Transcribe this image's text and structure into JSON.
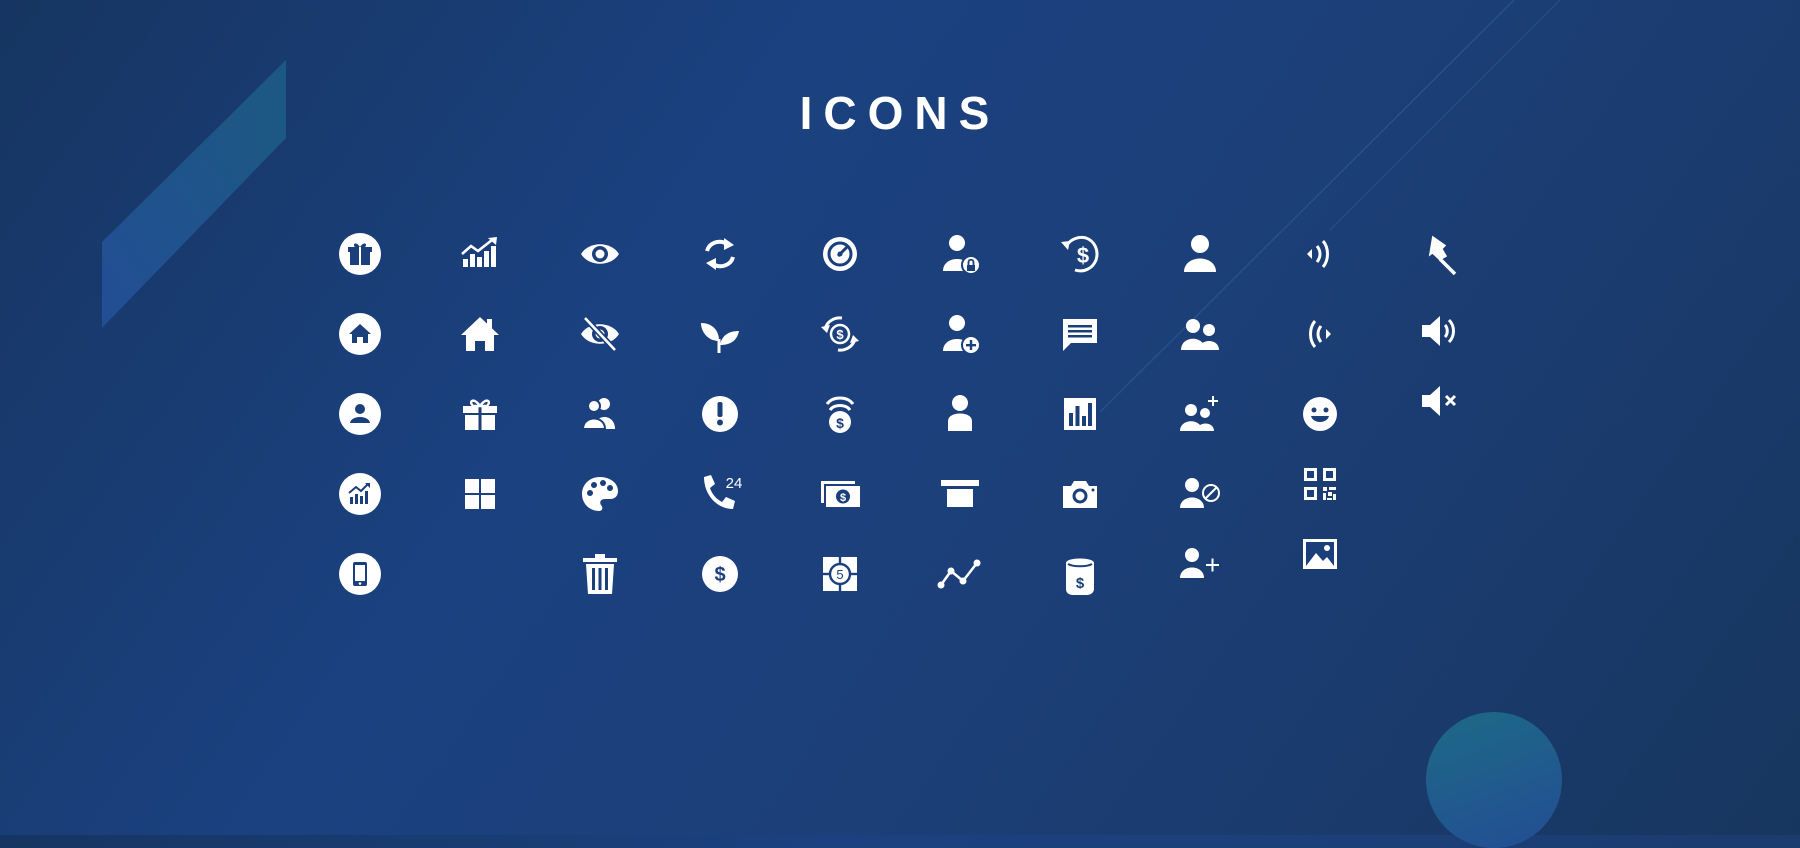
{
  "title": "ICONS",
  "colors": {
    "background_start": "#163561",
    "background_end": "#17365f",
    "icon": "#ffffff",
    "accent_teal": "#1d6a86"
  },
  "icon_grid": {
    "columns": [
      [
        "gift-circle-icon",
        "home-circle-icon",
        "user-circle-icon",
        "growth-chart-circle-icon",
        "smartphone-circle-icon"
      ],
      [
        "growth-chart-icon",
        "house-icon",
        "gift-box-icon",
        "windows-grid-icon"
      ],
      [
        "eye-icon",
        "eye-slash-icon",
        "users-pair-icon",
        "palette-icon",
        "trash-icon"
      ],
      [
        "refresh-arrows-icon",
        "sprout-icon",
        "alert-circle-icon",
        "phone-24-icon",
        "dollar-circle-icon"
      ],
      [
        "speed-refresh-icon",
        "dollar-cycle-icon",
        "dollar-signal-icon",
        "banknote-icon",
        "target-five-icon"
      ],
      [
        "user-lock-icon",
        "user-add-circle-icon",
        "person-icon",
        "atm-card-slot-icon",
        "trend-line-icon"
      ],
      [
        "dollar-history-icon",
        "chat-message-icon",
        "bar-chart-icon",
        "camera-icon",
        "money-bag-icon"
      ],
      [
        "user-icon",
        "users-group-icon",
        "users-add-icon",
        "user-blocked-icon",
        "user-plus-icon"
      ],
      [
        "contactless-signal-icon",
        "radio-waves-icon",
        "smiley-icon",
        "qr-code-icon",
        "image-icon"
      ],
      [
        "pushpin-icon",
        "volume-up-icon",
        "volume-mute-icon"
      ]
    ],
    "phone_24_text": "24",
    "target_five_text": "5"
  }
}
